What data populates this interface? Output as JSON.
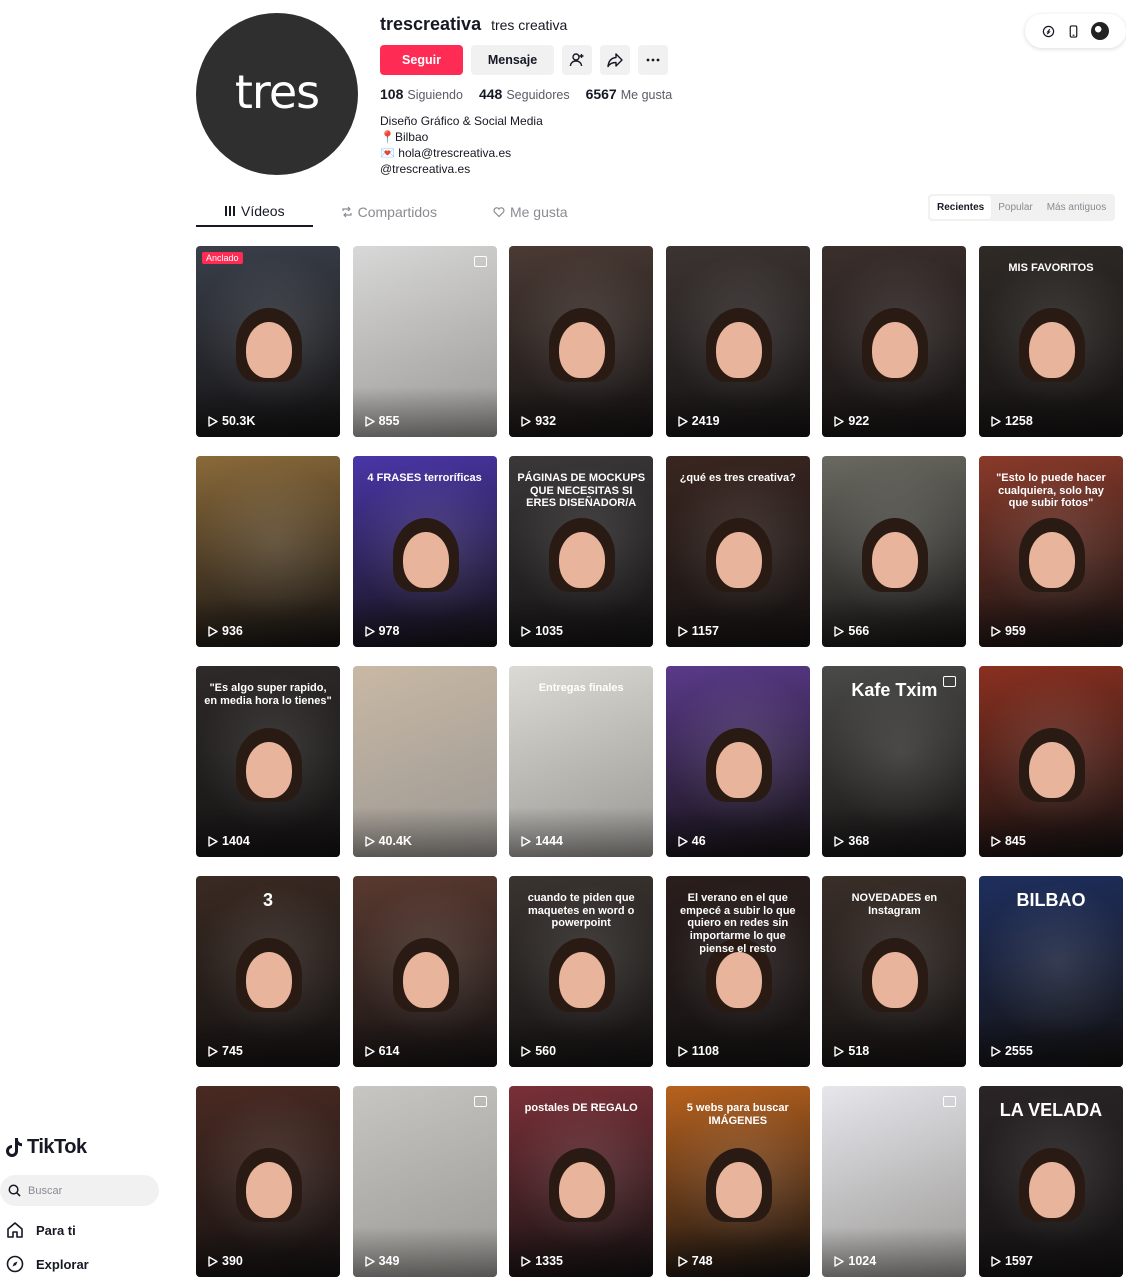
{
  "app": {
    "name": "TikTok",
    "search_placeholder": "Buscar",
    "nav": [
      {
        "label": "Para ti",
        "icon": "home-icon"
      },
      {
        "label": "Explorar",
        "icon": "compass-icon"
      }
    ]
  },
  "profile": {
    "avatar_text": "tres",
    "username": "trescreativa",
    "display_name": "tres creativa",
    "follow_label": "Seguir",
    "message_label": "Mensaje",
    "stats": [
      {
        "value": "108",
        "label": "Siguiendo"
      },
      {
        "value": "448",
        "label": "Seguidores"
      },
      {
        "value": "6567",
        "label": "Me gusta"
      }
    ],
    "bio": [
      "Diseño Gráfico & Social Media",
      "📍Bilbao",
      "💌 hola@trescreativa.es",
      "@trescreativa.es"
    ]
  },
  "tabs": [
    {
      "label": "Vídeos",
      "icon": "grid-icon",
      "active": true
    },
    {
      "label": "Compartidos",
      "icon": "repost-icon",
      "active": false
    },
    {
      "label": "Me gusta",
      "icon": "heart-icon",
      "active": false
    }
  ],
  "sort": [
    {
      "label": "Recientes",
      "active": true
    },
    {
      "label": "Popular",
      "active": false
    },
    {
      "label": "Más antiguos",
      "active": false
    }
  ],
  "pinned_label": "Anclado",
  "videos": [
    {
      "views": "50.3K",
      "pinned": true,
      "bg": "#3a3f4a",
      "text": ""
    },
    {
      "views": "855",
      "photo": true,
      "bg": "#d8d8d8",
      "text": ""
    },
    {
      "views": "932",
      "bg": "#4a3a34",
      "text": ""
    },
    {
      "views": "2419",
      "bg": "#3c3432",
      "text": ""
    },
    {
      "views": "922",
      "bg": "#3b2f2c",
      "text": ""
    },
    {
      "views": "1258",
      "bg": "#2f2a26",
      "text": "MIS FAVORITOS"
    },
    {
      "views": "936",
      "bg": "#8a6a3a",
      "text": ""
    },
    {
      "views": "978",
      "bg": "#4a36a8",
      "text": "4 FRASES terroríficas"
    },
    {
      "views": "1035",
      "bg": "#3a3838",
      "text": "PÁGINAS DE MOCKUPS QUE NECESITAS SI ERES DISEÑADOR/A"
    },
    {
      "views": "1157",
      "bg": "#3a2620",
      "text": "¿qué es tres creativa?"
    },
    {
      "views": "566",
      "bg": "#6a6a62",
      "text": ""
    },
    {
      "views": "959",
      "bg": "#8a3a2a",
      "text": "\"Esto lo puede hacer cualquiera, solo hay que subir fotos\""
    },
    {
      "views": "1404",
      "bg": "#2e2a2a",
      "text": "\"Es algo super rapido, en media hora lo tienes\""
    },
    {
      "views": "40.4K",
      "bg": "#c9b8a4",
      "text": ""
    },
    {
      "views": "1444",
      "bg": "#dcdad4",
      "text": "Entregas finales"
    },
    {
      "views": "46",
      "bg": "#5a3a8a",
      "text": ""
    },
    {
      "views": "368",
      "photo": true,
      "bg": "#4a4a48",
      "text": "Kafe Txim"
    },
    {
      "views": "845",
      "bg": "#8a3020",
      "text": ""
    },
    {
      "views": "745",
      "bg": "#3a2a22",
      "text": "3"
    },
    {
      "views": "614",
      "bg": "#5a3a30",
      "text": ""
    },
    {
      "views": "560",
      "bg": "#3a3430",
      "text": "cuando te piden que maquetes en word o powerpoint"
    },
    {
      "views": "1108",
      "bg": "#2a1e1c",
      "text": "El verano en el que empecé a subir lo que quiero en redes sin importarme lo que piense el resto"
    },
    {
      "views": "518",
      "bg": "#3a2e28",
      "text": "NOVEDADES en Instagram"
    },
    {
      "views": "2555",
      "bg": "#1e2f5e",
      "text": "BILBAO"
    },
    {
      "views": "390",
      "bg": "#4a2a22",
      "text": ""
    },
    {
      "views": "349",
      "photo": true,
      "bg": "#c8c6c2",
      "text": ""
    },
    {
      "views": "1335",
      "bg": "#7a3038",
      "text": "postales DE REGALO"
    },
    {
      "views": "748",
      "bg": "#b8621e",
      "text": "5 webs para buscar IMÁGENES"
    },
    {
      "views": "1024",
      "photo": true,
      "bg": "#e6e6ec",
      "text": ""
    },
    {
      "views": "1597",
      "bg": "#2a2426",
      "text": "LA VELADA"
    }
  ]
}
